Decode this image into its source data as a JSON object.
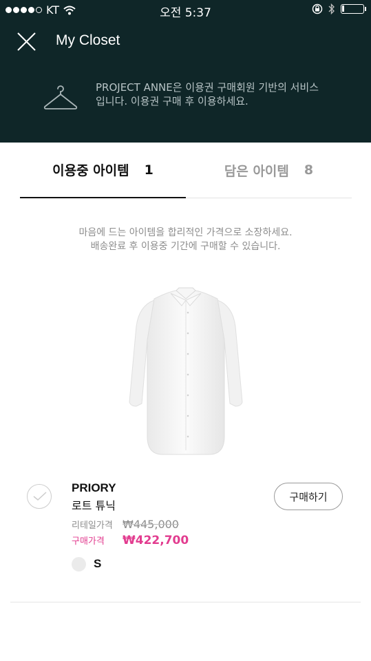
{
  "status_bar": {
    "carrier": "KT",
    "time": "오전 5:37"
  },
  "header": {
    "title": "My Closet",
    "notice_line1": "PROJECT ANNE은 이용권 구매회원 기반의 서비스",
    "notice_line2": "입니다. 이용권 구매 후 이용하세요."
  },
  "tabs": [
    {
      "label": "이용중 아이템",
      "count": "1",
      "active": true
    },
    {
      "label": "담은 아이템",
      "count": "8",
      "active": false
    }
  ],
  "description": {
    "line1": "마음에 드는 아이템을 합리적인 가격으로 소장하세요.",
    "line2": "배송완료 후 이용중 기간에 구매할 수 있습니다."
  },
  "item": {
    "brand": "PRIORY",
    "name": "로트 튜닉",
    "retail_label": "리테일가격",
    "retail_price": "₩445,000",
    "sale_label": "구매가격",
    "sale_price": "₩422,700",
    "size": "S",
    "buy_label": "구매하기"
  },
  "colors": {
    "header_bg": "#0f2628",
    "accent_pink": "#e23c8f"
  }
}
